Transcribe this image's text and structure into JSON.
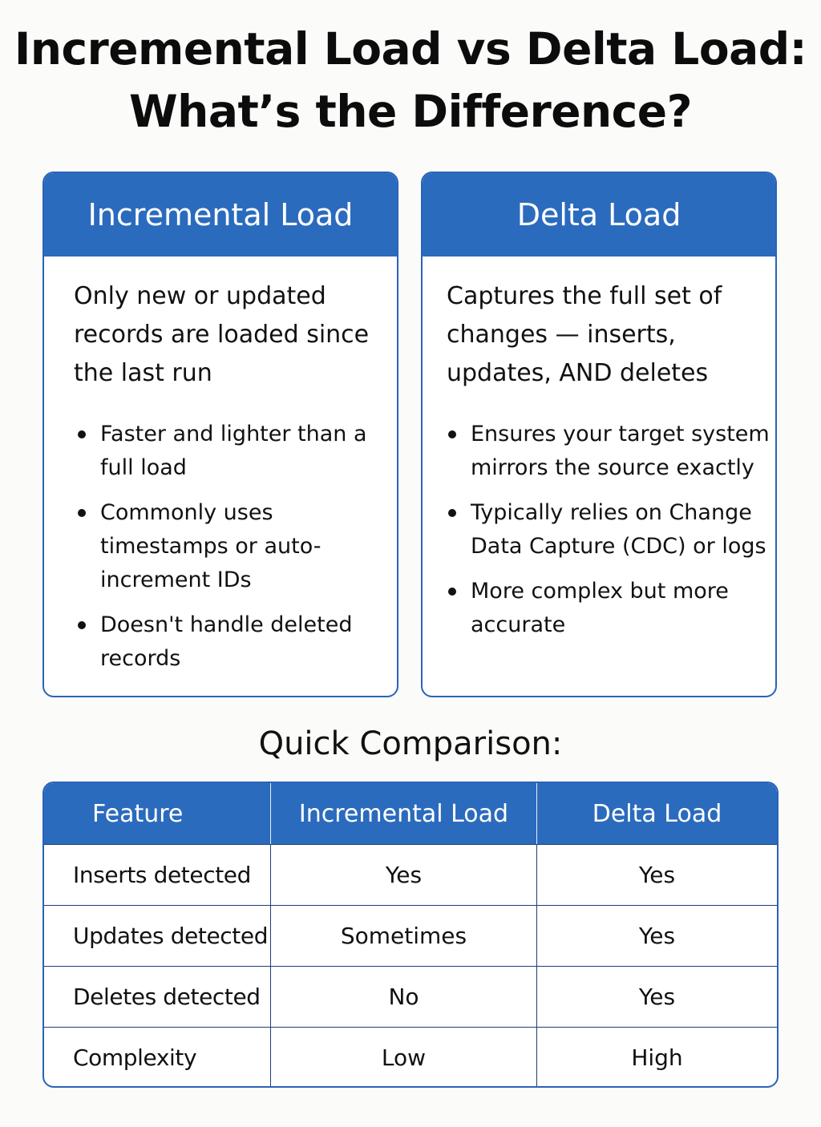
{
  "title": {
    "line1": "Incremental Load vs Delta Load:",
    "line2": "What’s the Difference?"
  },
  "cards": [
    {
      "header": "Incremental Load",
      "description": "Only new or updated records are loaded since the last run",
      "bullets": [
        "Faster and lighter than a full load",
        "Commonly uses timestamps or auto-increment IDs",
        "Doesn't handle deleted records"
      ]
    },
    {
      "header": "Delta Load",
      "description": "Captures the full set of changes — inserts, updates, AND deletes",
      "bullets": [
        "Ensures your target system mirrors the source exactly",
        "Typically relies on Change Data Capture (CDC) or logs",
        "More complex but more accurate"
      ]
    }
  ],
  "comparison": {
    "title": "Quick Comparison:",
    "headers": [
      "Feature",
      "Incremental Load",
      "Delta Load"
    ],
    "rows": [
      [
        "Inserts detected",
        "Yes",
        "Yes"
      ],
      [
        "Updates detected",
        "Sometimes",
        "Yes"
      ],
      [
        "Deletes detected",
        "No",
        "Yes"
      ],
      [
        "Complexity",
        "Low",
        "High"
      ]
    ]
  },
  "colors": {
    "accent": "#2b6bbd",
    "border": "#2a63b8",
    "background": "#fbfbf9"
  }
}
